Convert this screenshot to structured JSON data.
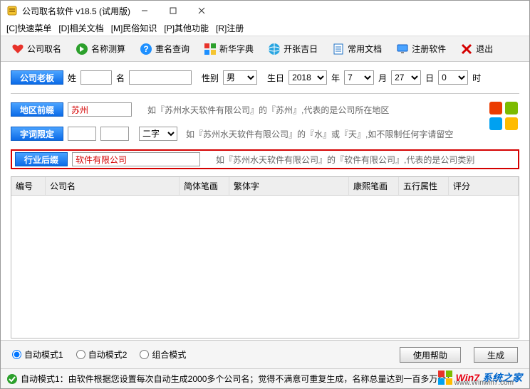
{
  "window": {
    "title": "公司取名软件 v18.5 (试用版)"
  },
  "menu": {
    "item1": "[C]快速菜单",
    "item2": "[D]相关文档",
    "item3": "[M]民俗知识",
    "item4": "[P]其他功能",
    "item5": "[R]注册"
  },
  "toolbar": {
    "btn1": "公司取名",
    "btn2": "名称测算",
    "btn3": "重名查询",
    "btn4": "新华字典",
    "btn5": "开张吉日",
    "btn6": "常用文档",
    "btn7": "注册软件",
    "btn8": "退出"
  },
  "form": {
    "boss_btn": "公司老板",
    "surname_label": "姓",
    "surname_value": "",
    "name_label": "名",
    "name_value": "",
    "gender_label": "性别",
    "gender_value": "男",
    "birth_label": "生日",
    "year": "2018",
    "year_label": "年",
    "month": "7",
    "month_label": "月",
    "day": "27",
    "day_label": "日",
    "hour": "0",
    "hour_label": "时",
    "region_btn": "地区前缀",
    "region_value": "苏州",
    "region_hint": "如『苏州水天软件有限公司』的『苏州』,代表的是公司所在地区",
    "limit_btn": "字词限定",
    "limit_v1": "",
    "limit_v2": "",
    "limit_sel": "二字",
    "limit_hint": "如『苏州水天软件有限公司』的『水』或『天』,如不限制任何字请留空",
    "industry_btn": "行业后缀",
    "industry_value": "软件有限公司",
    "industry_hint": "如『苏州水天软件有限公司』的『软件有限公司』,代表的是公司类别"
  },
  "table": {
    "col1": "编号",
    "col2": "公司名",
    "col3": "简体笔画",
    "col4": "繁体字",
    "col5": "康熙笔画",
    "col6": "五行属性",
    "col7": "评分"
  },
  "bottom": {
    "mode1": "自动模式1",
    "mode2": "自动模式2",
    "mode3": "组合模式",
    "help_btn": "使用帮助",
    "gen_btn": "生成"
  },
  "status": {
    "text": "自动模式1：由软件根据您设置每次自动生成2000多个公司名；觉得不满意可重复生成，名称总量达到一百多万个；"
  },
  "watermark": {
    "t1": "Win7",
    "t2": "系统之家",
    "sub": "www.Winwin7.com"
  }
}
